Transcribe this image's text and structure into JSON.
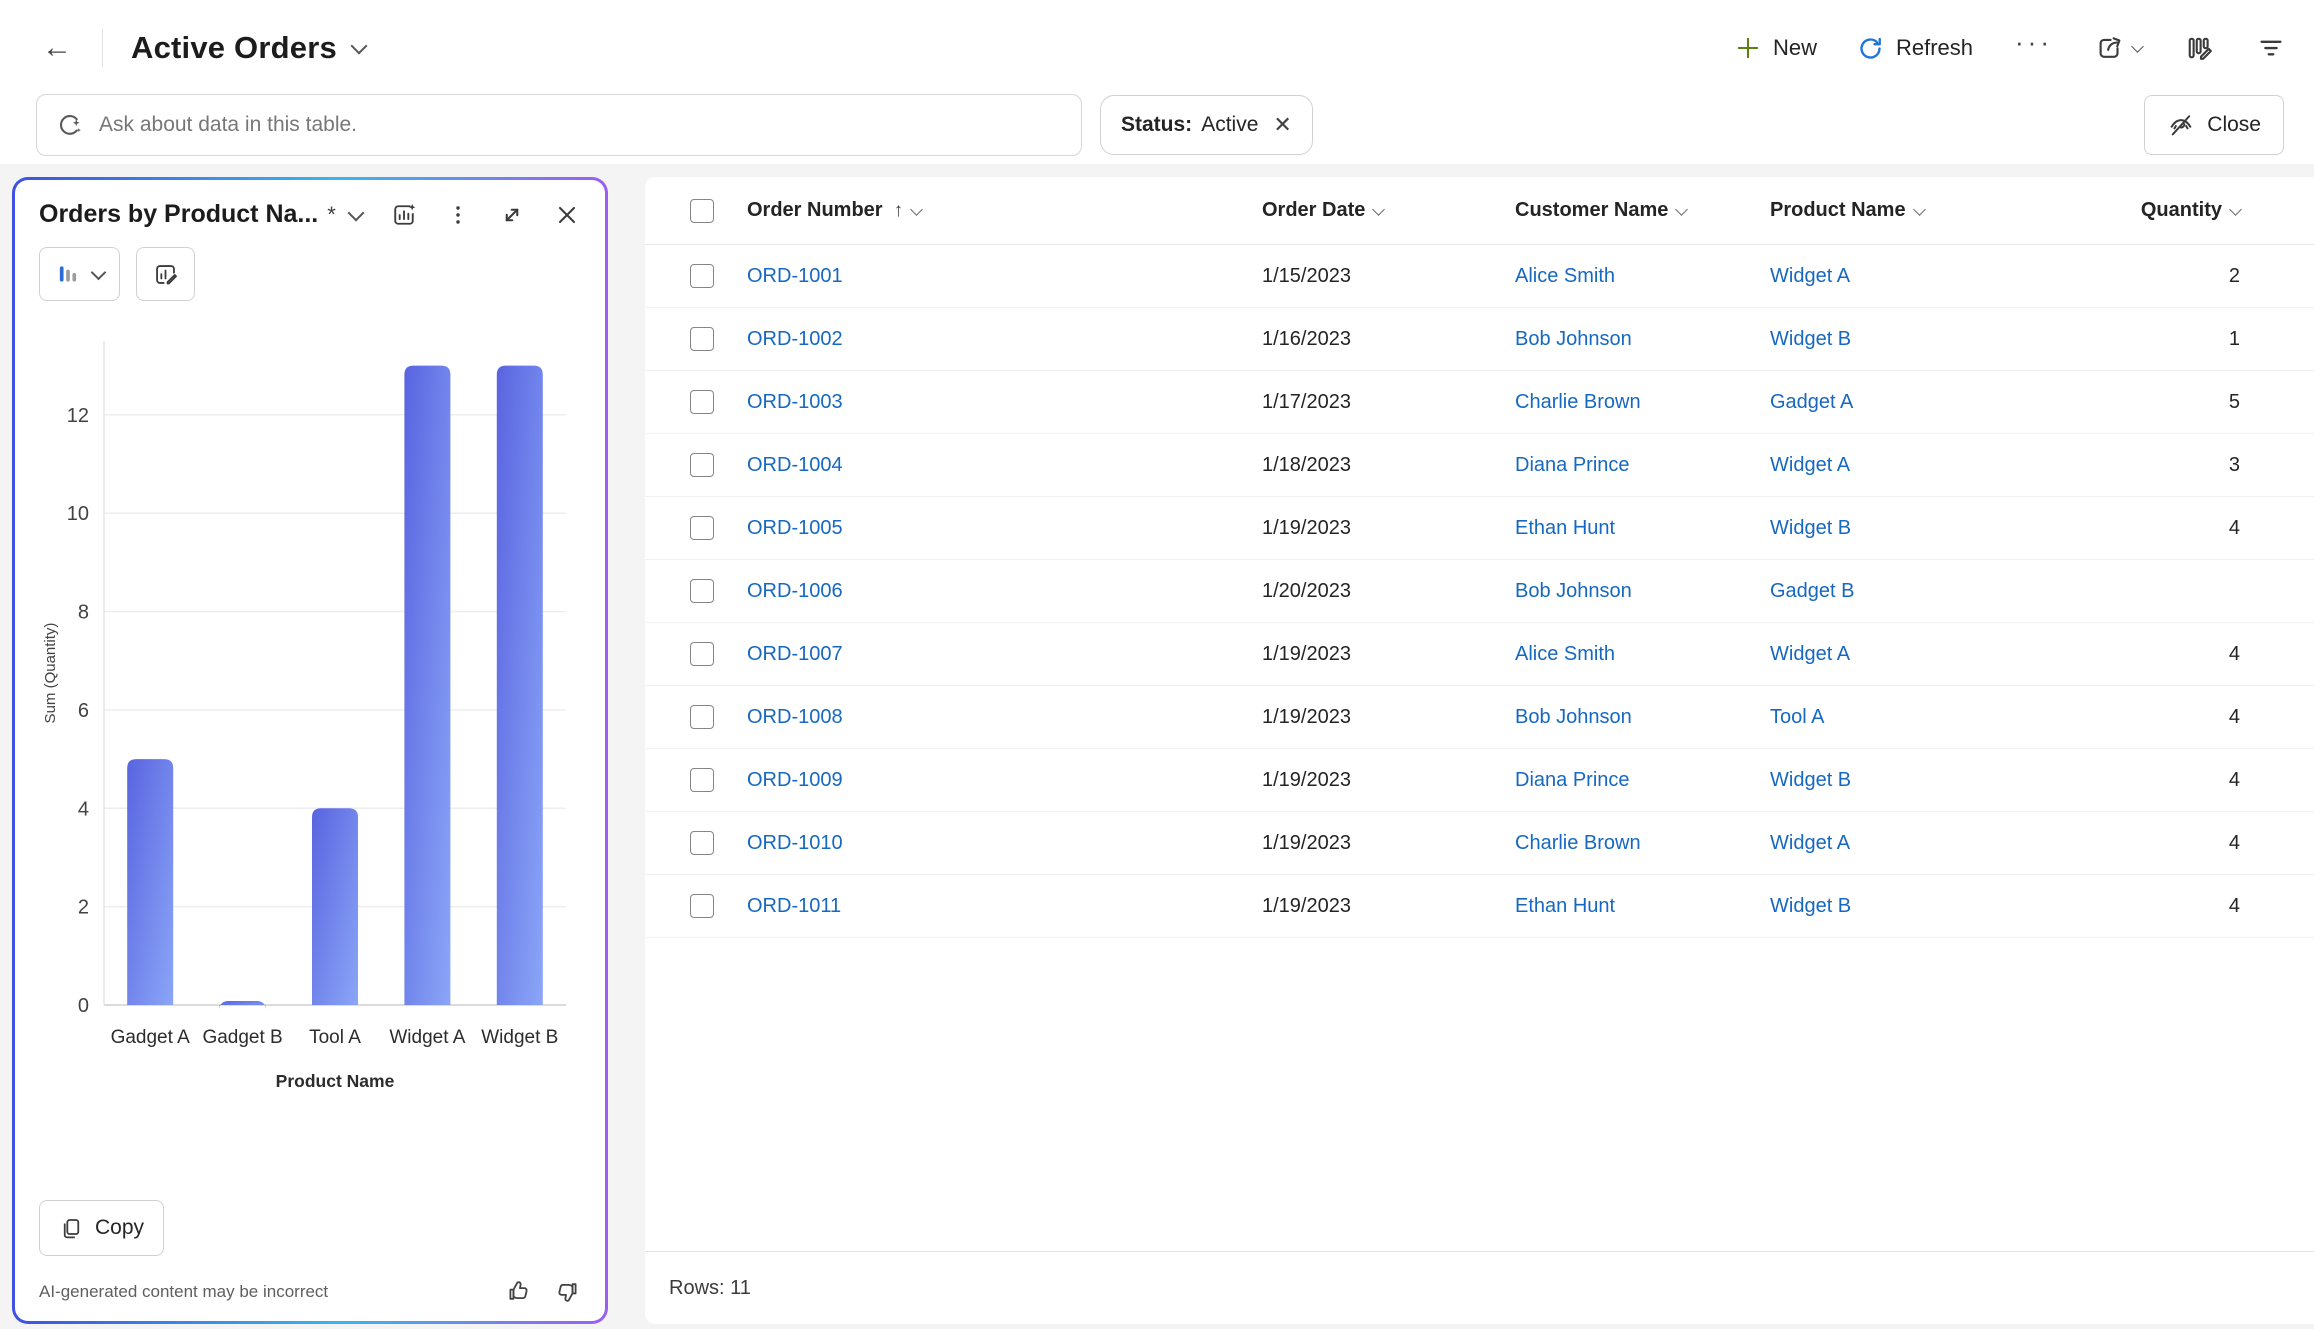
{
  "topbar": {
    "title": "Active Orders",
    "new_label": "New",
    "refresh_label": "Refresh",
    "more_label": "···",
    "close_label": "Close"
  },
  "search": {
    "placeholder": "Ask about data in this table."
  },
  "filter_chip": {
    "field": "Status:",
    "value": "Active"
  },
  "chart_card": {
    "title": "Orders by Product Na...",
    "unsaved_marker": "*",
    "copy_label": "Copy",
    "ai_note": "AI-generated content may be incorrect"
  },
  "chart_data": {
    "type": "bar",
    "title": "Orders by Product Name",
    "categories": [
      "Gadget A",
      "Gadget B",
      "Tool A",
      "Widget A",
      "Widget B"
    ],
    "values": [
      5,
      0,
      4,
      13,
      13
    ],
    "xlabel": "Product Name",
    "ylabel": "Sum (Quantity)",
    "yticks": [
      0,
      2,
      4,
      6,
      8,
      10,
      12
    ],
    "ylim": [
      0,
      13.5
    ],
    "grid": true,
    "bar_gradient": [
      "#5964e0",
      "#8ba6f7"
    ]
  },
  "table": {
    "columns": [
      "Order Number",
      "Order Date",
      "Customer Name",
      "Product Name",
      "Quantity"
    ],
    "sorted_column": "Order Number",
    "sort_direction": "asc",
    "rows": [
      {
        "order_number": "ORD-1001",
        "order_date": "1/15/2023",
        "customer": "Alice Smith",
        "product": "Widget A",
        "quantity": "2"
      },
      {
        "order_number": "ORD-1002",
        "order_date": "1/16/2023",
        "customer": "Bob Johnson",
        "product": "Widget B",
        "quantity": "1"
      },
      {
        "order_number": "ORD-1003",
        "order_date": "1/17/2023",
        "customer": "Charlie Brown",
        "product": "Gadget A",
        "quantity": "5"
      },
      {
        "order_number": "ORD-1004",
        "order_date": "1/18/2023",
        "customer": "Diana Prince",
        "product": "Widget A",
        "quantity": "3"
      },
      {
        "order_number": "ORD-1005",
        "order_date": "1/19/2023",
        "customer": "Ethan Hunt",
        "product": "Widget B",
        "quantity": "4"
      },
      {
        "order_number": "ORD-1006",
        "order_date": "1/20/2023",
        "customer": "Bob Johnson",
        "product": "Gadget B",
        "quantity": ""
      },
      {
        "order_number": "ORD-1007",
        "order_date": "1/19/2023",
        "customer": "Alice Smith",
        "product": "Widget A",
        "quantity": "4"
      },
      {
        "order_number": "ORD-1008",
        "order_date": "1/19/2023",
        "customer": "Bob Johnson",
        "product": "Tool A",
        "quantity": "4"
      },
      {
        "order_number": "ORD-1009",
        "order_date": "1/19/2023",
        "customer": "Diana Prince",
        "product": "Widget B",
        "quantity": "4"
      },
      {
        "order_number": "ORD-1010",
        "order_date": "1/19/2023",
        "customer": "Charlie Brown",
        "product": "Widget A",
        "quantity": "4"
      },
      {
        "order_number": "ORD-1011",
        "order_date": "1/19/2023",
        "customer": "Ethan Hunt",
        "product": "Widget B",
        "quantity": "4"
      }
    ],
    "rows_label": "Rows: 11"
  },
  "colors": {
    "link": "#1668c1",
    "new_plus_green": "#5c7e12",
    "refresh_blue": "#2274d9",
    "card_border_gradient": [
      "#3f51e3",
      "#38b6ee",
      "#9c5ef2"
    ],
    "background": "#f4f4f4",
    "panel": "#ffffff"
  }
}
